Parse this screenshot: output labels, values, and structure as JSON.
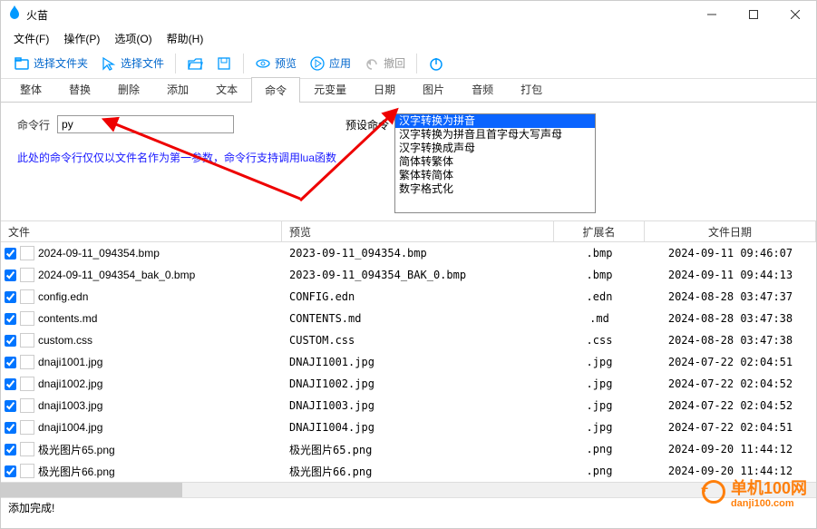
{
  "window": {
    "title": "火苗"
  },
  "menus": {
    "file": "文件(F)",
    "operate": "操作(P)",
    "options": "选项(O)",
    "help": "帮助(H)"
  },
  "toolbar": {
    "select_folder": "选择文件夹",
    "select_files": "选择文件",
    "preview": "预览",
    "apply": "应用",
    "undo": "撤回"
  },
  "tabs": {
    "items": [
      "整体",
      "替换",
      "删除",
      "添加",
      "文本",
      "命令",
      "元变量",
      "日期",
      "图片",
      "音频",
      "打包"
    ],
    "active_index": 5
  },
  "panel": {
    "cmd_label": "命令行",
    "cmd_value": "py",
    "hint": "此处的命令行仅仅以文件名作为第一参数，命令行支持调用lua函数",
    "preset_label": "预设命令",
    "preset_options": [
      "汉字转换为拼音",
      "汉字转换为拼音且首字母大写声母",
      "汉字转换成声母",
      "简体转繁体",
      "繁体转简体",
      "数字格式化"
    ],
    "preset_selected_index": 0
  },
  "grid": {
    "headers": {
      "file": "文件",
      "preview": "预览",
      "ext": "扩展名",
      "date": "文件日期"
    },
    "rows": [
      {
        "file": "2024-09-11_094354.bmp",
        "preview": "2023-09-11_094354.bmp",
        "ext": ".bmp",
        "date": "2024-09-11 09:46:07"
      },
      {
        "file": "2024-09-11_094354_bak_0.bmp",
        "preview": "2023-09-11_094354_BAK_0.bmp",
        "ext": ".bmp",
        "date": "2024-09-11 09:44:13"
      },
      {
        "file": "config.edn",
        "preview": "CONFIG.edn",
        "ext": ".edn",
        "date": "2024-08-28 03:47:37"
      },
      {
        "file": "contents.md",
        "preview": "CONTENTS.md",
        "ext": ".md",
        "date": "2024-08-28 03:47:38"
      },
      {
        "file": "custom.css",
        "preview": "CUSTOM.css",
        "ext": ".css",
        "date": "2024-08-28 03:47:38"
      },
      {
        "file": "dnaji1001.jpg",
        "preview": "DNAJI1001.jpg",
        "ext": ".jpg",
        "date": "2024-07-22 02:04:51"
      },
      {
        "file": "dnaji1002.jpg",
        "preview": "DNAJI1002.jpg",
        "ext": ".jpg",
        "date": "2024-07-22 02:04:52"
      },
      {
        "file": "dnaji1003.jpg",
        "preview": "DNAJI1003.jpg",
        "ext": ".jpg",
        "date": "2024-07-22 02:04:52"
      },
      {
        "file": "dnaji1004.jpg",
        "preview": "DNAJI1004.jpg",
        "ext": ".jpg",
        "date": "2024-07-22 02:04:51"
      },
      {
        "file": "极光图片65.png",
        "preview": "极光图片65.png",
        "ext": ".png",
        "date": "2024-09-20 11:44:12"
      },
      {
        "file": "极光图片66.png",
        "preview": "极光图片66.png",
        "ext": ".png",
        "date": "2024-09-20 11:44:12"
      }
    ]
  },
  "status": {
    "text": "添加完成!"
  },
  "watermark": {
    "line1": "单机100网",
    "line2": "danji100.com"
  }
}
